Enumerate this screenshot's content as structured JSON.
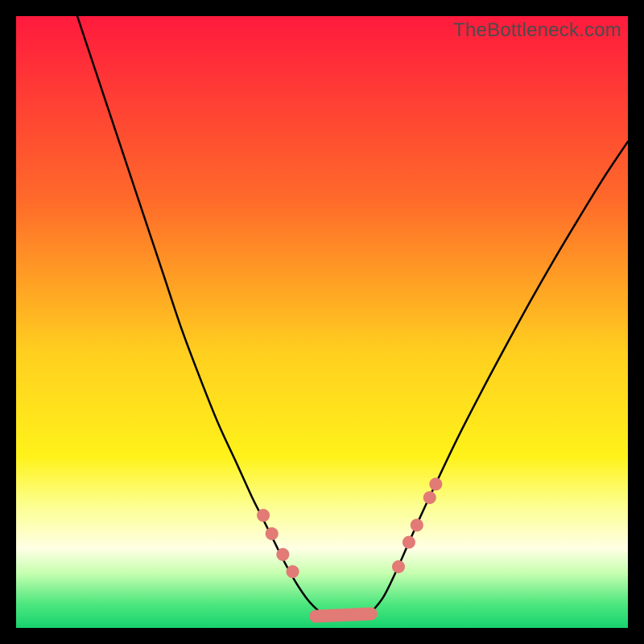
{
  "watermark": "TheBottleneck.com",
  "chart_data": {
    "type": "line",
    "title": "",
    "xlabel": "",
    "ylabel": "",
    "xlim": [
      0,
      100
    ],
    "ylim": [
      0,
      100
    ],
    "background_gradient": {
      "stops": [
        {
          "offset": 0.0,
          "color": "#ff1a3d"
        },
        {
          "offset": 0.3,
          "color": "#ff6a2a"
        },
        {
          "offset": 0.55,
          "color": "#ffcf1f"
        },
        {
          "offset": 0.72,
          "color": "#fff21a"
        },
        {
          "offset": 0.8,
          "color": "#fcff8f"
        },
        {
          "offset": 0.87,
          "color": "#ffffe5"
        },
        {
          "offset": 0.91,
          "color": "#c7ffb0"
        },
        {
          "offset": 0.96,
          "color": "#4fe77f"
        },
        {
          "offset": 1.0,
          "color": "#17d36e"
        }
      ]
    },
    "series": [
      {
        "name": "left-curve",
        "stroke": "#000000",
        "stroke_width": 2.5,
        "points": [
          {
            "x": 10.0,
            "y": 100.0
          },
          {
            "x": 12.0,
            "y": 94.0
          },
          {
            "x": 15.0,
            "y": 85.0
          },
          {
            "x": 18.0,
            "y": 76.0
          },
          {
            "x": 21.0,
            "y": 67.0
          },
          {
            "x": 24.0,
            "y": 58.0
          },
          {
            "x": 27.0,
            "y": 49.0
          },
          {
            "x": 30.0,
            "y": 41.0
          },
          {
            "x": 33.0,
            "y": 33.5
          },
          {
            "x": 36.0,
            "y": 27.0
          },
          {
            "x": 38.5,
            "y": 21.5
          },
          {
            "x": 40.0,
            "y": 18.5
          },
          {
            "x": 42.0,
            "y": 14.5
          },
          {
            "x": 44.0,
            "y": 10.5
          },
          {
            "x": 46.0,
            "y": 7.0
          },
          {
            "x": 48.0,
            "y": 4.2
          },
          {
            "x": 50.0,
            "y": 2.4
          },
          {
            "x": 52.0,
            "y": 1.7
          },
          {
            "x": 54.0,
            "y": 1.6
          },
          {
            "x": 56.0,
            "y": 1.7
          },
          {
            "x": 58.0,
            "y": 2.5
          }
        ]
      },
      {
        "name": "right-curve",
        "stroke": "#000000",
        "stroke_width": 2.5,
        "points": [
          {
            "x": 58.0,
            "y": 2.5
          },
          {
            "x": 60.0,
            "y": 5.0
          },
          {
            "x": 62.0,
            "y": 9.0
          },
          {
            "x": 64.0,
            "y": 13.5
          },
          {
            "x": 66.0,
            "y": 18.0
          },
          {
            "x": 68.0,
            "y": 22.3
          },
          {
            "x": 72.0,
            "y": 30.7
          },
          {
            "x": 76.0,
            "y": 38.5
          },
          {
            "x": 80.0,
            "y": 46.0
          },
          {
            "x": 84.0,
            "y": 53.3
          },
          {
            "x": 88.0,
            "y": 60.3
          },
          {
            "x": 92.0,
            "y": 67.0
          },
          {
            "x": 96.0,
            "y": 73.5
          },
          {
            "x": 100.0,
            "y": 79.5
          }
        ]
      }
    ],
    "markers": {
      "fill": "#e27a75",
      "radius": 8,
      "points_round": [
        {
          "x": 40.4,
          "y": 18.4
        },
        {
          "x": 41.8,
          "y": 15.4
        },
        {
          "x": 43.6,
          "y": 12.0
        },
        {
          "x": 45.2,
          "y": 9.2
        },
        {
          "x": 62.5,
          "y": 10.0
        },
        {
          "x": 64.2,
          "y": 14.0
        },
        {
          "x": 65.5,
          "y": 16.8
        },
        {
          "x": 67.6,
          "y": 21.3
        },
        {
          "x": 68.6,
          "y": 23.5
        }
      ],
      "capsules": [
        {
          "x1": 49.0,
          "y1": 1.9,
          "x2": 58.0,
          "y2": 2.3
        }
      ]
    }
  }
}
